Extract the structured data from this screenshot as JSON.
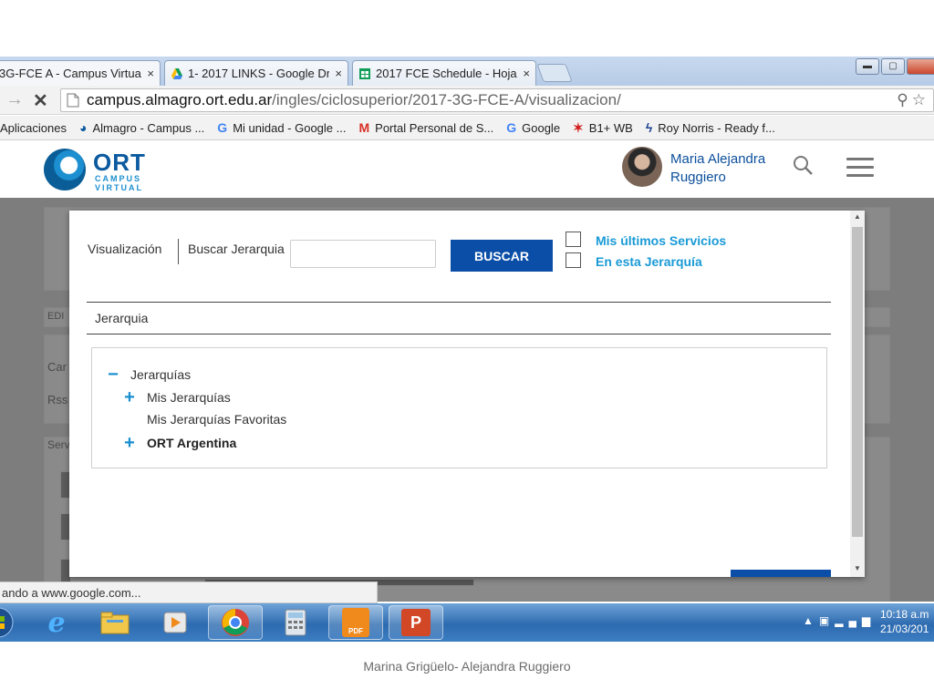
{
  "browser": {
    "tabs": [
      {
        "label": "3G-FCE A - Campus Virtua",
        "close": "×",
        "icon": "ort-favicon"
      },
      {
        "label": "1- 2017 LINKS - Google Dr",
        "close": "×",
        "icon": "google-drive-icon"
      },
      {
        "label": "2017 FCE Schedule - Hoja",
        "close": "×",
        "icon": "google-sheets-icon"
      }
    ],
    "url_host": "campus.almagro.ort.edu.ar",
    "url_path": "/ingles/ciclosuperior/2017-3G-FCE-A/visualizacion/",
    "bookmarks": [
      {
        "label": "Aplicaciones",
        "icon": ""
      },
      {
        "label": "Almagro - Campus ...",
        "icon": "ort-favicon"
      },
      {
        "label": "Mi unidad - Google ...",
        "icon": "google-g-icon"
      },
      {
        "label": "Portal Personal de S...",
        "icon": "gmail-icon"
      },
      {
        "label": "Google",
        "icon": "google-g-icon"
      },
      {
        "label": "B1+ WB",
        "icon": "b1-icon"
      },
      {
        "label": "Roy Norris - Ready f...",
        "icon": "roy-norris-icon"
      }
    ],
    "status": "ando a www.google.com..."
  },
  "header": {
    "logo_main": "ORT",
    "logo_sub1": "CAMPUS",
    "logo_sub2": "VIRTUAL",
    "user_first": "Maria Alejandra",
    "user_last": "Ruggiero"
  },
  "background": {
    "edit": "EDI",
    "c1": "Car",
    "c2": "Rss",
    "s1": "Serv"
  },
  "modal": {
    "visualizacion": "Visualización",
    "buscar_label": "Buscar Jerarquia",
    "search_value": "",
    "buscar_button": "BUSCAR",
    "check1_label": "Mis últimos Servicios",
    "check2_label": "En esta Jerarquía",
    "jerarquia_header": "Jerarquia",
    "tree": [
      {
        "sign": "−",
        "label": "Jerarquías",
        "level": 0
      },
      {
        "sign": "+",
        "label": "Mis Jerarquías",
        "level": 1
      },
      {
        "sign": "",
        "label": "Mis Jerarquías Favoritas",
        "level": 1
      },
      {
        "sign": "+",
        "label": "ORT Argentina",
        "level": 1
      }
    ]
  },
  "taskbar": {
    "apps": [
      "start-orb",
      "internet-explorer-icon",
      "file-explorer-icon",
      "media-player-icon",
      "chrome-icon",
      "calculator-icon",
      "pdf-icon",
      "powerpoint-icon"
    ],
    "pdf_label": "PDF",
    "time": "10:18 a.m",
    "date": "21/03/201"
  },
  "footer": "Marina Grigüelo- Alejandra Ruggiero",
  "colors": {
    "brand_blue": "#0a4ea8",
    "link_blue": "#1a9ad6",
    "overlay_gray": "#7d7d7d"
  }
}
